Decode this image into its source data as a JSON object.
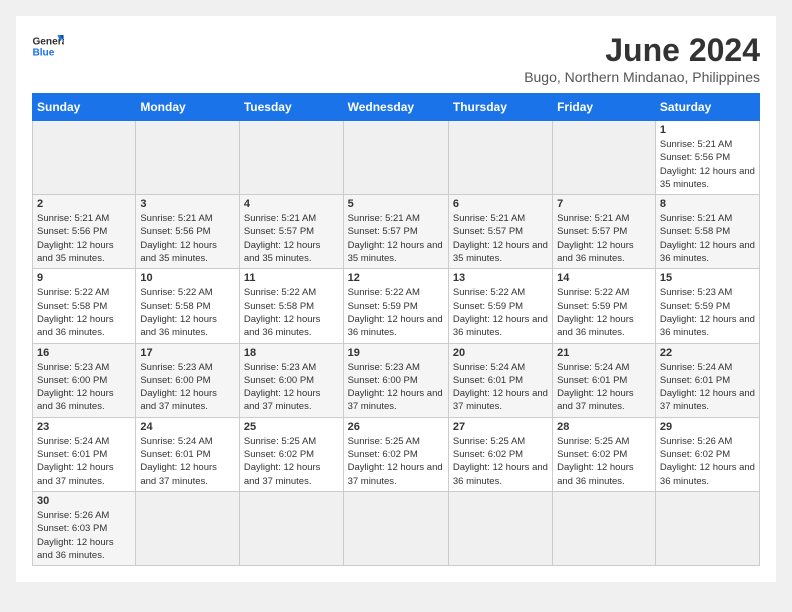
{
  "header": {
    "logo_line1": "General",
    "logo_line2": "Blue",
    "title": "June 2024",
    "subtitle": "Bugo, Northern Mindanao, Philippines"
  },
  "weekdays": [
    "Sunday",
    "Monday",
    "Tuesday",
    "Wednesday",
    "Thursday",
    "Friday",
    "Saturday"
  ],
  "weeks": [
    [
      {
        "day": "",
        "empty": true
      },
      {
        "day": "",
        "empty": true
      },
      {
        "day": "",
        "empty": true
      },
      {
        "day": "",
        "empty": true
      },
      {
        "day": "",
        "empty": true
      },
      {
        "day": "",
        "empty": true
      },
      {
        "day": "1",
        "sunrise": "5:21 AM",
        "sunset": "5:56 PM",
        "daylight": "12 hours and 35 minutes."
      }
    ],
    [
      {
        "day": "2",
        "sunrise": "5:21 AM",
        "sunset": "5:56 PM",
        "daylight": "12 hours and 35 minutes."
      },
      {
        "day": "3",
        "sunrise": "5:21 AM",
        "sunset": "5:56 PM",
        "daylight": "12 hours and 35 minutes."
      },
      {
        "day": "4",
        "sunrise": "5:21 AM",
        "sunset": "5:57 PM",
        "daylight": "12 hours and 35 minutes."
      },
      {
        "day": "5",
        "sunrise": "5:21 AM",
        "sunset": "5:57 PM",
        "daylight": "12 hours and 35 minutes."
      },
      {
        "day": "6",
        "sunrise": "5:21 AM",
        "sunset": "5:57 PM",
        "daylight": "12 hours and 35 minutes."
      },
      {
        "day": "7",
        "sunrise": "5:21 AM",
        "sunset": "5:57 PM",
        "daylight": "12 hours and 36 minutes."
      },
      {
        "day": "8",
        "sunrise": "5:21 AM",
        "sunset": "5:58 PM",
        "daylight": "12 hours and 36 minutes."
      }
    ],
    [
      {
        "day": "9",
        "sunrise": "5:22 AM",
        "sunset": "5:58 PM",
        "daylight": "12 hours and 36 minutes."
      },
      {
        "day": "10",
        "sunrise": "5:22 AM",
        "sunset": "5:58 PM",
        "daylight": "12 hours and 36 minutes."
      },
      {
        "day": "11",
        "sunrise": "5:22 AM",
        "sunset": "5:58 PM",
        "daylight": "12 hours and 36 minutes."
      },
      {
        "day": "12",
        "sunrise": "5:22 AM",
        "sunset": "5:59 PM",
        "daylight": "12 hours and 36 minutes."
      },
      {
        "day": "13",
        "sunrise": "5:22 AM",
        "sunset": "5:59 PM",
        "daylight": "12 hours and 36 minutes."
      },
      {
        "day": "14",
        "sunrise": "5:22 AM",
        "sunset": "5:59 PM",
        "daylight": "12 hours and 36 minutes."
      },
      {
        "day": "15",
        "sunrise": "5:23 AM",
        "sunset": "5:59 PM",
        "daylight": "12 hours and 36 minutes."
      }
    ],
    [
      {
        "day": "16",
        "sunrise": "5:23 AM",
        "sunset": "6:00 PM",
        "daylight": "12 hours and 36 minutes."
      },
      {
        "day": "17",
        "sunrise": "5:23 AM",
        "sunset": "6:00 PM",
        "daylight": "12 hours and 37 minutes."
      },
      {
        "day": "18",
        "sunrise": "5:23 AM",
        "sunset": "6:00 PM",
        "daylight": "12 hours and 37 minutes."
      },
      {
        "day": "19",
        "sunrise": "5:23 AM",
        "sunset": "6:00 PM",
        "daylight": "12 hours and 37 minutes."
      },
      {
        "day": "20",
        "sunrise": "5:24 AM",
        "sunset": "6:01 PM",
        "daylight": "12 hours and 37 minutes."
      },
      {
        "day": "21",
        "sunrise": "5:24 AM",
        "sunset": "6:01 PM",
        "daylight": "12 hours and 37 minutes."
      },
      {
        "day": "22",
        "sunrise": "5:24 AM",
        "sunset": "6:01 PM",
        "daylight": "12 hours and 37 minutes."
      }
    ],
    [
      {
        "day": "23",
        "sunrise": "5:24 AM",
        "sunset": "6:01 PM",
        "daylight": "12 hours and 37 minutes."
      },
      {
        "day": "24",
        "sunrise": "5:24 AM",
        "sunset": "6:01 PM",
        "daylight": "12 hours and 37 minutes."
      },
      {
        "day": "25",
        "sunrise": "5:25 AM",
        "sunset": "6:02 PM",
        "daylight": "12 hours and 37 minutes."
      },
      {
        "day": "26",
        "sunrise": "5:25 AM",
        "sunset": "6:02 PM",
        "daylight": "12 hours and 37 minutes."
      },
      {
        "day": "27",
        "sunrise": "5:25 AM",
        "sunset": "6:02 PM",
        "daylight": "12 hours and 36 minutes."
      },
      {
        "day": "28",
        "sunrise": "5:25 AM",
        "sunset": "6:02 PM",
        "daylight": "12 hours and 36 minutes."
      },
      {
        "day": "29",
        "sunrise": "5:26 AM",
        "sunset": "6:02 PM",
        "daylight": "12 hours and 36 minutes."
      }
    ],
    [
      {
        "day": "30",
        "sunrise": "5:26 AM",
        "sunset": "6:03 PM",
        "daylight": "12 hours and 36 minutes."
      },
      {
        "day": "",
        "empty": true
      },
      {
        "day": "",
        "empty": true
      },
      {
        "day": "",
        "empty": true
      },
      {
        "day": "",
        "empty": true
      },
      {
        "day": "",
        "empty": true
      },
      {
        "day": "",
        "empty": true
      }
    ]
  ],
  "labels": {
    "sunrise": "Sunrise:",
    "sunset": "Sunset:",
    "daylight": "Daylight:"
  }
}
